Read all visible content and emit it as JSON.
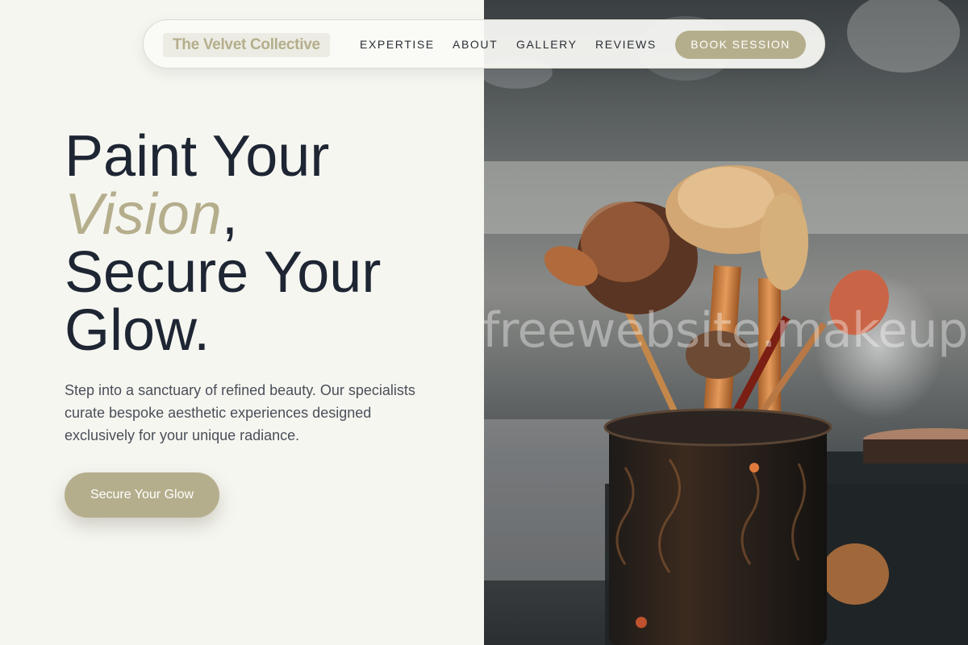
{
  "brand": {
    "name": "The Velvet Collective"
  },
  "nav": {
    "links": [
      "EXPERTISE",
      "ABOUT",
      "GALLERY",
      "REVIEWS"
    ],
    "cta": "BOOK SESSION"
  },
  "hero": {
    "line1": "Paint Your",
    "accent": "Vision",
    "accent_suffix": ",",
    "line3": "Secure Your",
    "line4": "Glow.",
    "description": "Step into a sanctuary of refined beauty. Our specialists curate bespoke aesthetic experiences designed exclusively for your unique radiance.",
    "cta": "Secure Your Glow"
  },
  "image": {
    "subject": "makeup brushes in ornate cup",
    "watermark": "freewebsite.makeup"
  },
  "colors": {
    "accent": "#b5ae8c",
    "heading": "#1e2533",
    "background": "#f6f6f1",
    "body_text": "#4a4f58"
  }
}
